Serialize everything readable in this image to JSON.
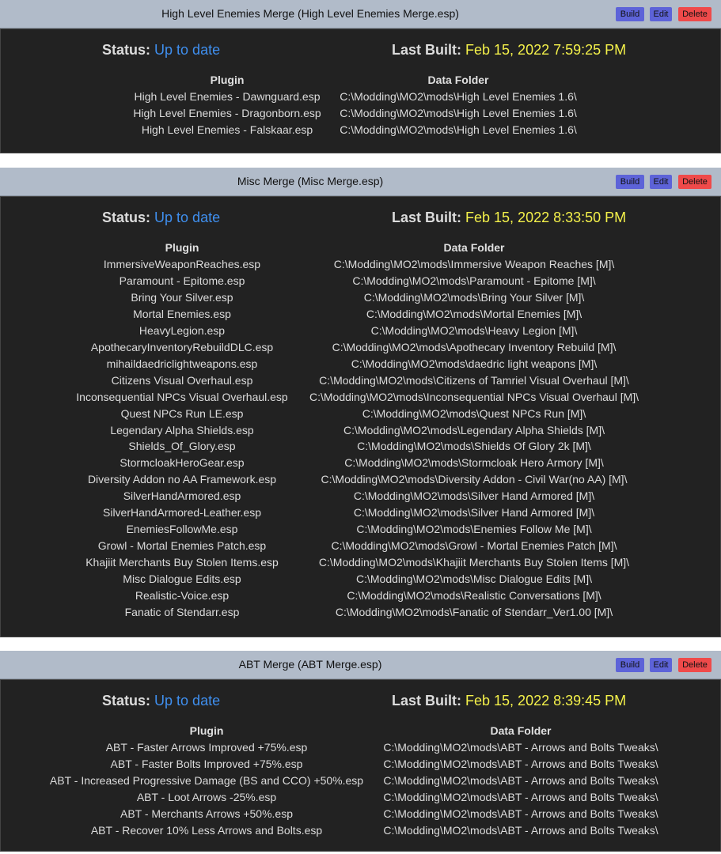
{
  "merges": [
    {
      "title": "High Level Enemies Merge (High Level Enemies Merge.esp)",
      "buttons": {
        "build": "Build",
        "edit": "Edit",
        "delete": "Delete"
      },
      "status_label": "Status:",
      "status_value": "Up to date",
      "last_built_label": "Last Built:",
      "last_built_value": "Feb 15, 2022 7:59:25 PM",
      "columns": {
        "plugin": "Plugin",
        "data_folder": "Data Folder"
      },
      "rows": [
        {
          "plugin": "High Level Enemies - Dawnguard.esp",
          "folder": "C:\\Modding\\MO2\\mods\\High Level Enemies 1.6\\"
        },
        {
          "plugin": "High Level Enemies - Dragonborn.esp",
          "folder": "C:\\Modding\\MO2\\mods\\High Level Enemies 1.6\\"
        },
        {
          "plugin": "High Level Enemies - Falskaar.esp",
          "folder": "C:\\Modding\\MO2\\mods\\High Level Enemies 1.6\\"
        }
      ]
    },
    {
      "title": "Misc Merge (Misc Merge.esp)",
      "buttons": {
        "build": "Build",
        "edit": "Edit",
        "delete": "Delete"
      },
      "status_label": "Status:",
      "status_value": "Up to date",
      "last_built_label": "Last Built:",
      "last_built_value": "Feb 15, 2022 8:33:50 PM",
      "columns": {
        "plugin": "Plugin",
        "data_folder": "Data Folder"
      },
      "rows": [
        {
          "plugin": "ImmersiveWeaponReaches.esp",
          "folder": "C:\\Modding\\MO2\\mods\\Immersive Weapon Reaches [M]\\"
        },
        {
          "plugin": "Paramount - Epitome.esp",
          "folder": "C:\\Modding\\MO2\\mods\\Paramount - Epitome [M]\\"
        },
        {
          "plugin": "Bring Your Silver.esp",
          "folder": "C:\\Modding\\MO2\\mods\\Bring Your Silver [M]\\"
        },
        {
          "plugin": "Mortal Enemies.esp",
          "folder": "C:\\Modding\\MO2\\mods\\Mortal Enemies [M]\\"
        },
        {
          "plugin": "HeavyLegion.esp",
          "folder": "C:\\Modding\\MO2\\mods\\Heavy Legion [M]\\"
        },
        {
          "plugin": "ApothecaryInventoryRebuildDLC.esp",
          "folder": "C:\\Modding\\MO2\\mods\\Apothecary Inventory Rebuild [M]\\"
        },
        {
          "plugin": "mihaildaedriclightweapons.esp",
          "folder": "C:\\Modding\\MO2\\mods\\daedric light weapons [M]\\"
        },
        {
          "plugin": "Citizens Visual Overhaul.esp",
          "folder": "C:\\Modding\\MO2\\mods\\Citizens of Tamriel Visual Overhaul [M]\\"
        },
        {
          "plugin": "Inconsequential NPCs Visual Overhaul.esp",
          "folder": "C:\\Modding\\MO2\\mods\\Inconsequential NPCs Visual Overhaul [M]\\"
        },
        {
          "plugin": "Quest NPCs Run LE.esp",
          "folder": "C:\\Modding\\MO2\\mods\\Quest NPCs Run [M]\\"
        },
        {
          "plugin": "Legendary Alpha Shields.esp",
          "folder": "C:\\Modding\\MO2\\mods\\Legendary Alpha Shields [M]\\"
        },
        {
          "plugin": "Shields_Of_Glory.esp",
          "folder": "C:\\Modding\\MO2\\mods\\Shields Of Glory 2k [M]\\"
        },
        {
          "plugin": "StormcloakHeroGear.esp",
          "folder": "C:\\Modding\\MO2\\mods\\Stormcloak Hero Armory [M]\\"
        },
        {
          "plugin": "Diversity Addon no AA Framework.esp",
          "folder": "C:\\Modding\\MO2\\mods\\Diversity Addon - Civil War(no AA) [M]\\"
        },
        {
          "plugin": "SilverHandArmored.esp",
          "folder": "C:\\Modding\\MO2\\mods\\Silver Hand Armored [M]\\"
        },
        {
          "plugin": "SilverHandArmored-Leather.esp",
          "folder": "C:\\Modding\\MO2\\mods\\Silver Hand Armored [M]\\"
        },
        {
          "plugin": "EnemiesFollowMe.esp",
          "folder": "C:\\Modding\\MO2\\mods\\Enemies Follow Me [M]\\"
        },
        {
          "plugin": "Growl - Mortal Enemies Patch.esp",
          "folder": "C:\\Modding\\MO2\\mods\\Growl - Mortal Enemies Patch [M]\\"
        },
        {
          "plugin": "Khajiit Merchants Buy Stolen Items.esp",
          "folder": "C:\\Modding\\MO2\\mods\\Khajiit Merchants Buy Stolen Items [M]\\"
        },
        {
          "plugin": "Misc Dialogue Edits.esp",
          "folder": "C:\\Modding\\MO2\\mods\\Misc Dialogue Edits [M]\\"
        },
        {
          "plugin": "Realistic-Voice.esp",
          "folder": "C:\\Modding\\MO2\\mods\\Realistic Conversations [M]\\"
        },
        {
          "plugin": "Fanatic of Stendarr.esp",
          "folder": "C:\\Modding\\MO2\\mods\\Fanatic of Stendarr_Ver1.00 [M]\\"
        }
      ]
    },
    {
      "title": "ABT Merge (ABT Merge.esp)",
      "buttons": {
        "build": "Build",
        "edit": "Edit",
        "delete": "Delete"
      },
      "status_label": "Status:",
      "status_value": "Up to date",
      "last_built_label": "Last Built:",
      "last_built_value": "Feb 15, 2022 8:39:45 PM",
      "columns": {
        "plugin": "Plugin",
        "data_folder": "Data Folder"
      },
      "rows": [
        {
          "plugin": "ABT - Faster Arrows Improved +75%.esp",
          "folder": "C:\\Modding\\MO2\\mods\\ABT - Arrows and Bolts Tweaks\\"
        },
        {
          "plugin": "ABT - Faster Bolts Improved +75%.esp",
          "folder": "C:\\Modding\\MO2\\mods\\ABT - Arrows and Bolts Tweaks\\"
        },
        {
          "plugin": "ABT - Increased Progressive Damage (BS and CCO) +50%.esp",
          "folder": "C:\\Modding\\MO2\\mods\\ABT - Arrows and Bolts Tweaks\\"
        },
        {
          "plugin": "ABT - Loot Arrows -25%.esp",
          "folder": "C:\\Modding\\MO2\\mods\\ABT - Arrows and Bolts Tweaks\\"
        },
        {
          "plugin": "ABT - Merchants Arrows +50%.esp",
          "folder": "C:\\Modding\\MO2\\mods\\ABT - Arrows and Bolts Tweaks\\"
        },
        {
          "plugin": "ABT - Recover 10% Less Arrows and Bolts.esp",
          "folder": "C:\\Modding\\MO2\\mods\\ABT - Arrows and Bolts Tweaks\\"
        }
      ]
    }
  ]
}
